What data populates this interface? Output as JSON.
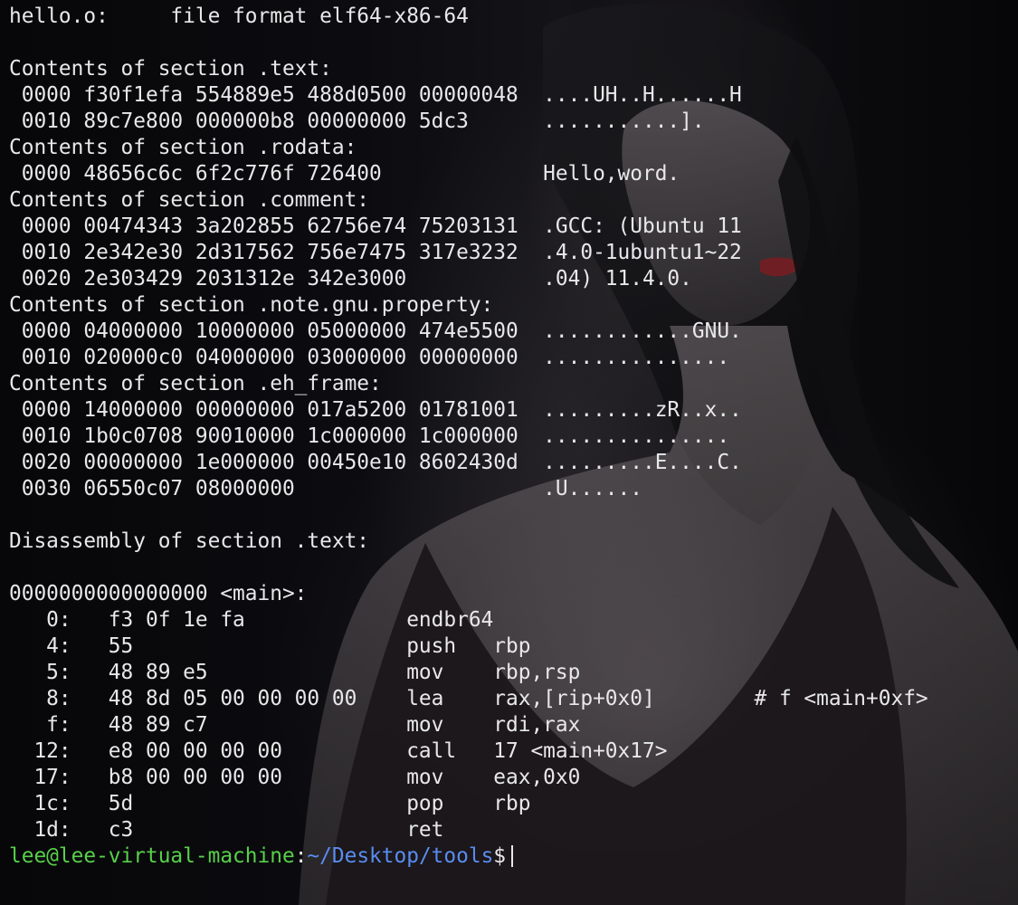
{
  "terminal": {
    "lines": [
      "hello.o:     file format elf64-x86-64",
      "",
      "Contents of section .text:",
      " 0000 f30f1efa 554889e5 488d0500 00000048  ....UH..H......H",
      " 0010 89c7e800 000000b8 00000000 5dc3      ...........].",
      "Contents of section .rodata:",
      " 0000 48656c6c 6f2c776f 726400             Hello,word.",
      "Contents of section .comment:",
      " 0000 00474343 3a202855 62756e74 75203131  .GCC: (Ubuntu 11",
      " 0010 2e342e30 2d317562 756e7475 317e3232  .4.0-1ubuntu1~22",
      " 0020 2e303429 2031312e 342e3000           .04) 11.4.0.",
      "Contents of section .note.gnu.property:",
      " 0000 04000000 10000000 05000000 474e5500  ............GNU.",
      " 0010 020000c0 04000000 03000000 00000000  ...............",
      "Contents of section .eh_frame:",
      " 0000 14000000 00000000 017a5200 01781001  .........zR..x..",
      " 0010 1b0c0708 90010000 1c000000 1c000000  ...............",
      " 0020 00000000 1e000000 00450e10 8602430d  .........E....C.",
      " 0030 06550c07 08000000                    .U......",
      "",
      "Disassembly of section .text:",
      "",
      "0000000000000000 <main>:",
      "   0:   f3 0f 1e fa             endbr64",
      "   4:   55                      push   rbp",
      "   5:   48 89 e5                mov    rbp,rsp",
      "   8:   48 8d 05 00 00 00 00    lea    rax,[rip+0x0]        # f <main+0xf>",
      "   f:   48 89 c7                mov    rdi,rax",
      "  12:   e8 00 00 00 00          call   17 <main+0x17>",
      "  17:   b8 00 00 00 00          mov    eax,0x0",
      "  1c:   5d                      pop    rbp",
      "  1d:   c3                      ret"
    ],
    "prompt": {
      "user_host": "lee@lee-virtual-machine",
      "colon": ":",
      "path": "~/Desktop/tools",
      "symbol": "$"
    }
  },
  "colors": {
    "text": "#e8e8ea",
    "user_host": "#58d04a",
    "path": "#5a8cf0",
    "background": "#0a0a0d"
  }
}
